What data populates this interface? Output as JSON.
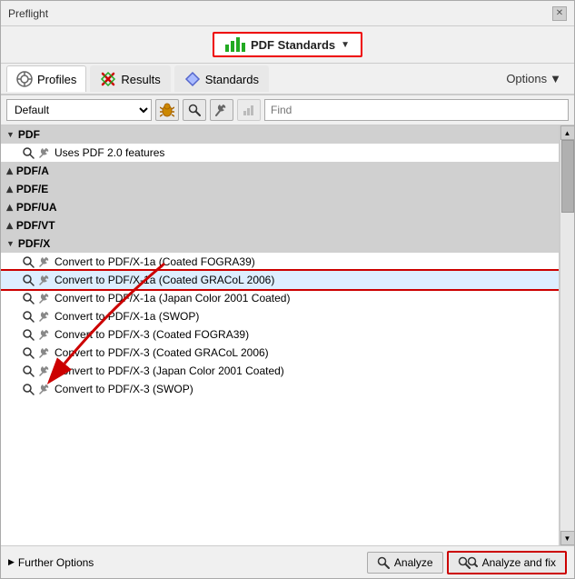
{
  "window": {
    "title": "Preflight"
  },
  "pdfStandardsBtn": {
    "label": "PDF Standards",
    "dropdown_arrow": "▼"
  },
  "tabs": [
    {
      "id": "profiles",
      "label": "Profiles",
      "active": true
    },
    {
      "id": "results",
      "label": "Results",
      "active": false
    },
    {
      "id": "standards",
      "label": "Standards",
      "active": false
    }
  ],
  "options_label": "Options",
  "toolbar": {
    "dropdown_value": "Default",
    "find_placeholder": "Find"
  },
  "treeGroups": [
    {
      "id": "pdf",
      "label": "PDF",
      "expanded": true,
      "items": [
        {
          "label": "Uses PDF 2.0 features"
        }
      ]
    },
    {
      "id": "pdfa",
      "label": "PDF/A",
      "expanded": false,
      "items": []
    },
    {
      "id": "pdfe",
      "label": "PDF/E",
      "expanded": false,
      "items": []
    },
    {
      "id": "pdfua",
      "label": "PDF/UA",
      "expanded": false,
      "items": []
    },
    {
      "id": "pdfvt",
      "label": "PDF/VT",
      "expanded": false,
      "items": []
    },
    {
      "id": "pdfx",
      "label": "PDF/X",
      "expanded": true,
      "items": [
        {
          "label": "Convert to PDF/X-1a (Coated FOGRA39)",
          "selected": false
        },
        {
          "label": "Convert to PDF/X-1a (Coated GRACoL 2006)",
          "selected": true
        },
        {
          "label": "Convert to PDF/X-1a (Japan Color 2001 Coated)",
          "selected": false
        },
        {
          "label": "Convert to PDF/X-1a (SWOP)",
          "selected": false
        },
        {
          "label": "Convert to PDF/X-3 (Coated FOGRA39)",
          "selected": false
        },
        {
          "label": "Convert to PDF/X-3 (Coated GRACoL 2006)",
          "selected": false
        },
        {
          "label": "Convert to PDF/X-3 (Japan Color 2001 Coated)",
          "selected": false
        },
        {
          "label": "Convert to PDF/X-3 (SWOP)",
          "selected": false
        }
      ]
    }
  ],
  "bottomBar": {
    "further_options_label": "Further Options",
    "analyze_label": "Analyze",
    "analyze_fix_label": "Analyze and fix"
  }
}
